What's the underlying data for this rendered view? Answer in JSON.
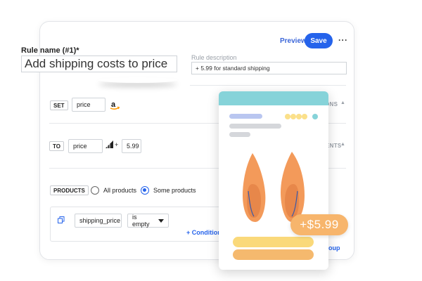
{
  "header": {
    "preview_label": "Preview",
    "save_label": "Save",
    "more_label": "···"
  },
  "rule": {
    "name_label": "Rule name (#1)*",
    "name_value": "Add shipping costs to price",
    "description_label": "Rule description",
    "description_value": "+ 5.99 for standard shipping"
  },
  "set_row": {
    "tag": "SET",
    "field": "price",
    "icon": "amazon-icon",
    "right_text": "ONS"
  },
  "to_row": {
    "tag": "TO",
    "field": "price",
    "icon": "signal-icon",
    "operator": "+",
    "value": "5.99",
    "right_text": "ENTS"
  },
  "products": {
    "tag": "PRODUCTS",
    "options": [
      {
        "label": "All products",
        "selected": false
      },
      {
        "label": "Some products",
        "selected": true
      }
    ]
  },
  "condition": {
    "field": "shipping_price",
    "operator": "is empty",
    "add_condition_label": "+ Condition",
    "add_group_label": "group"
  },
  "product_card": {
    "price_badge": "+$5.99",
    "colors": {
      "header": "#86d3d9",
      "shoe": "#f39a5a",
      "badge": "#f7b56c",
      "pill_yellow": "#fad97a",
      "pill_orange": "#f5b96e"
    }
  },
  "colors": {
    "accent": "#2563eb"
  }
}
